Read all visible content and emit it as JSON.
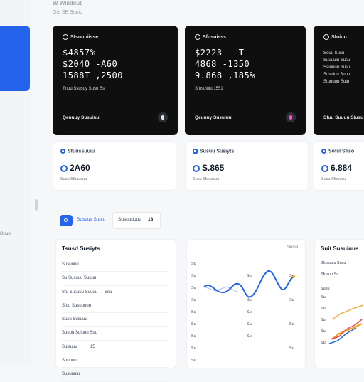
{
  "header": {
    "title": "W Wiiidiiut",
    "subtitle": "Gie SB Sonic"
  },
  "sidebar": {
    "bottom_label": "Ouuu"
  },
  "dark_cards": [
    {
      "title": "Sfsuuuiisse",
      "lines": [
        "$4857%",
        "$2040 -A60",
        "1588T ,2500"
      ],
      "caption": "Tnuu Ssusuy Susu Ssi",
      "footer": "Qeuuuy Susuiuu"
    },
    {
      "title": "Sfusuisss",
      "lines": [
        "$2223 - T",
        "4868 -1350",
        "9.868 ,185%"
      ],
      "caption": "Sfusuiuiu 1551",
      "footer": "Qeuuuy Susuiuu"
    },
    {
      "title": "Sfuiuu",
      "rows": [
        {
          "label": "Seuu Susu",
          "value": "Ssu"
        },
        {
          "label": "Suuuuiu Susu",
          "value": "Ssu"
        },
        {
          "label": "Saiuuuu Susu",
          "value": "Ssu"
        },
        {
          "label": "Susuiuu Suuu",
          "value": "Ssu"
        },
        {
          "label": "Stuuuuu Sulu",
          "value": "Ssu"
        }
      ],
      "footer": "Sfuu Suuuu Siusu"
    }
  ],
  "stat_cards": [
    {
      "title": "Sfuussuuiu",
      "value": "2A60",
      "caption": "Susu Sfuuusuu"
    },
    {
      "title": "Susuu Susiyts",
      "value": "S.865",
      "caption": "Susu Sfuuusuu"
    },
    {
      "title": "Sofsl Sfiso",
      "value": "6.884",
      "caption": "Susu Sfuuusu"
    }
  ],
  "tabs": {
    "active": "Susuus Suuiu",
    "second": "Susuuduuu",
    "second_count": "18"
  },
  "insights_panel": {
    "title": "Tsusd Susiyts",
    "rows": [
      {
        "label": "Susuuuu",
        "value": ""
      },
      {
        "label": "Su Susuuu Suuuu",
        "value": ""
      },
      {
        "label": "Sfu Susuuu Suuuu",
        "value": "Ssu"
      },
      {
        "label": "Sfuu Susuuuuu",
        "value": ""
      },
      {
        "label": "Susu Susuuu",
        "value": ""
      },
      {
        "label": "Suuuu Suiuuu Suu",
        "value": ""
      },
      {
        "label": "Suisuuu",
        "value": "15"
      },
      {
        "label": "Suuuuu",
        "value": ""
      },
      {
        "label": "Susuuuiu",
        "value": ""
      },
      {
        "label": "Sfuuu",
        "value": ""
      }
    ]
  },
  "line_panel": {
    "header": "Susuu",
    "y_labels": [
      "Su",
      "Su",
      "Su",
      "Su",
      "Su",
      "Su",
      "Su",
      "Su",
      "Su"
    ],
    "y_labels_right": [
      "Su",
      "Su",
      "Su",
      "Su",
      "Su",
      "Su",
      "Su",
      "Su",
      "Su"
    ],
    "series_color": "#2563eb"
  },
  "right_panel": {
    "title": "Suit Susuiuus",
    "y_labels": [
      "Sfusuuiu Susu",
      "Sfusuu Su",
      "Susu",
      "Su",
      "Su",
      "Su",
      "Su",
      "Su"
    ],
    "colors": [
      "#f59e0b",
      "#ef4444",
      "#2563eb"
    ]
  }
}
